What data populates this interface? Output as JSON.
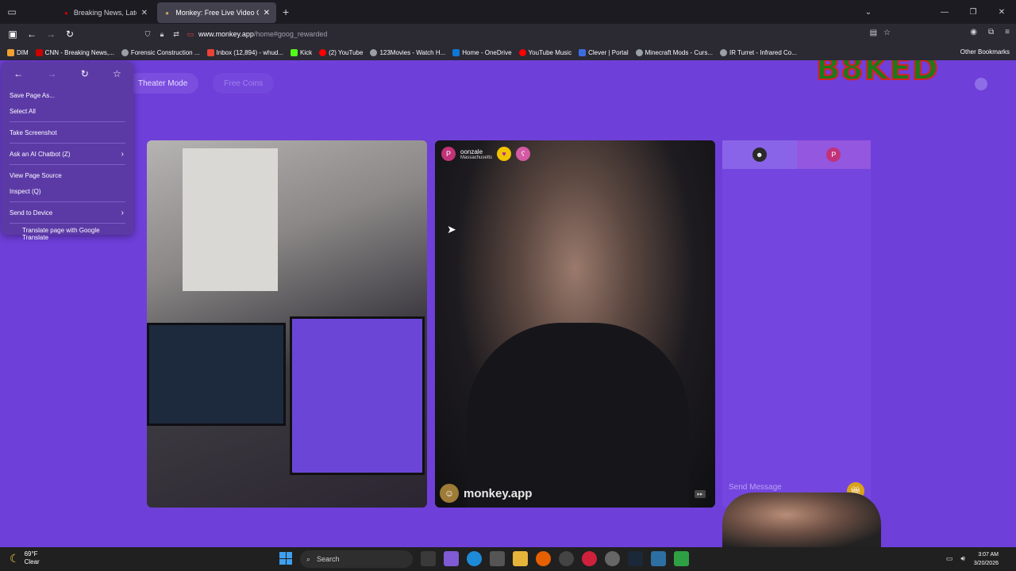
{
  "browser": {
    "tabs": [
      {
        "title": "Breaking News, Latest News",
        "favicon": "cnn-icon",
        "active": false
      },
      {
        "title": "Monkey: Free Live Video Ch",
        "favicon": "monkey-icon",
        "active": true
      }
    ],
    "url_host": "www.monkey.app",
    "url_path": "/home#goog_rewarded",
    "bookmarks": [
      {
        "label": "DIM",
        "color": "#f0a030"
      },
      {
        "label": "CNN - Breaking News,...",
        "color": "#cc0000"
      },
      {
        "label": "Forensic Construction ...",
        "color": "#9aa0a6"
      },
      {
        "label": "Inbox (12,894) - whud...",
        "color": "#ea4335"
      },
      {
        "label": "Kick",
        "color": "#53fc18"
      },
      {
        "label": "(2) YouTube",
        "color": "#ff0000"
      },
      {
        "label": "123Movies - Watch H...",
        "color": "#9aa0a6"
      },
      {
        "label": "Home - OneDrive",
        "color": "#0f78d4"
      },
      {
        "label": "YouTube Music",
        "color": "#ff0000"
      },
      {
        "label": "Clever | Portal",
        "color": "#3c6ce0"
      },
      {
        "label": "Minecraft Mods - Curs...",
        "color": "#9aa0a6"
      },
      {
        "label": "IR Turret - Infrared Co...",
        "color": "#9aa0a6"
      }
    ],
    "other_bookmarks": "Other Bookmarks"
  },
  "page": {
    "theater_mode": "Theater Mode",
    "free_coins": "Free Coins",
    "logo_text": "B8KED",
    "remote_user": {
      "name": "oonzale",
      "location": "Massachusetts",
      "avatar_letter": "P"
    },
    "watermark": "monkey.app",
    "chat": {
      "tab1_avatar": "dark-avatar",
      "tab2_letter": "P",
      "placeholder": "Send Message"
    }
  },
  "context_menu": {
    "items": [
      {
        "label": "Save Page As...",
        "arrow": false
      },
      {
        "label": "Select All",
        "arrow": false
      },
      {
        "label": "Take Screenshot",
        "arrow": false
      },
      {
        "label": "Ask an AI Chatbot (Z)",
        "arrow": true
      },
      {
        "label": "View Page Source",
        "arrow": false
      },
      {
        "label": "Inspect (Q)",
        "arrow": false
      },
      {
        "label": "Send to Device",
        "arrow": true
      },
      {
        "label": "Translate page with Google Translate",
        "arrow": false
      }
    ]
  },
  "taskbar": {
    "temperature": "69°F",
    "condition": "Clear",
    "search": "Search",
    "time": "3:07 AM",
    "date": "3/20/2026"
  },
  "colors": {
    "page_bg": "#6f3fd9",
    "menu_bg": "#5c3aa6",
    "accent_pink": "#c23279"
  }
}
